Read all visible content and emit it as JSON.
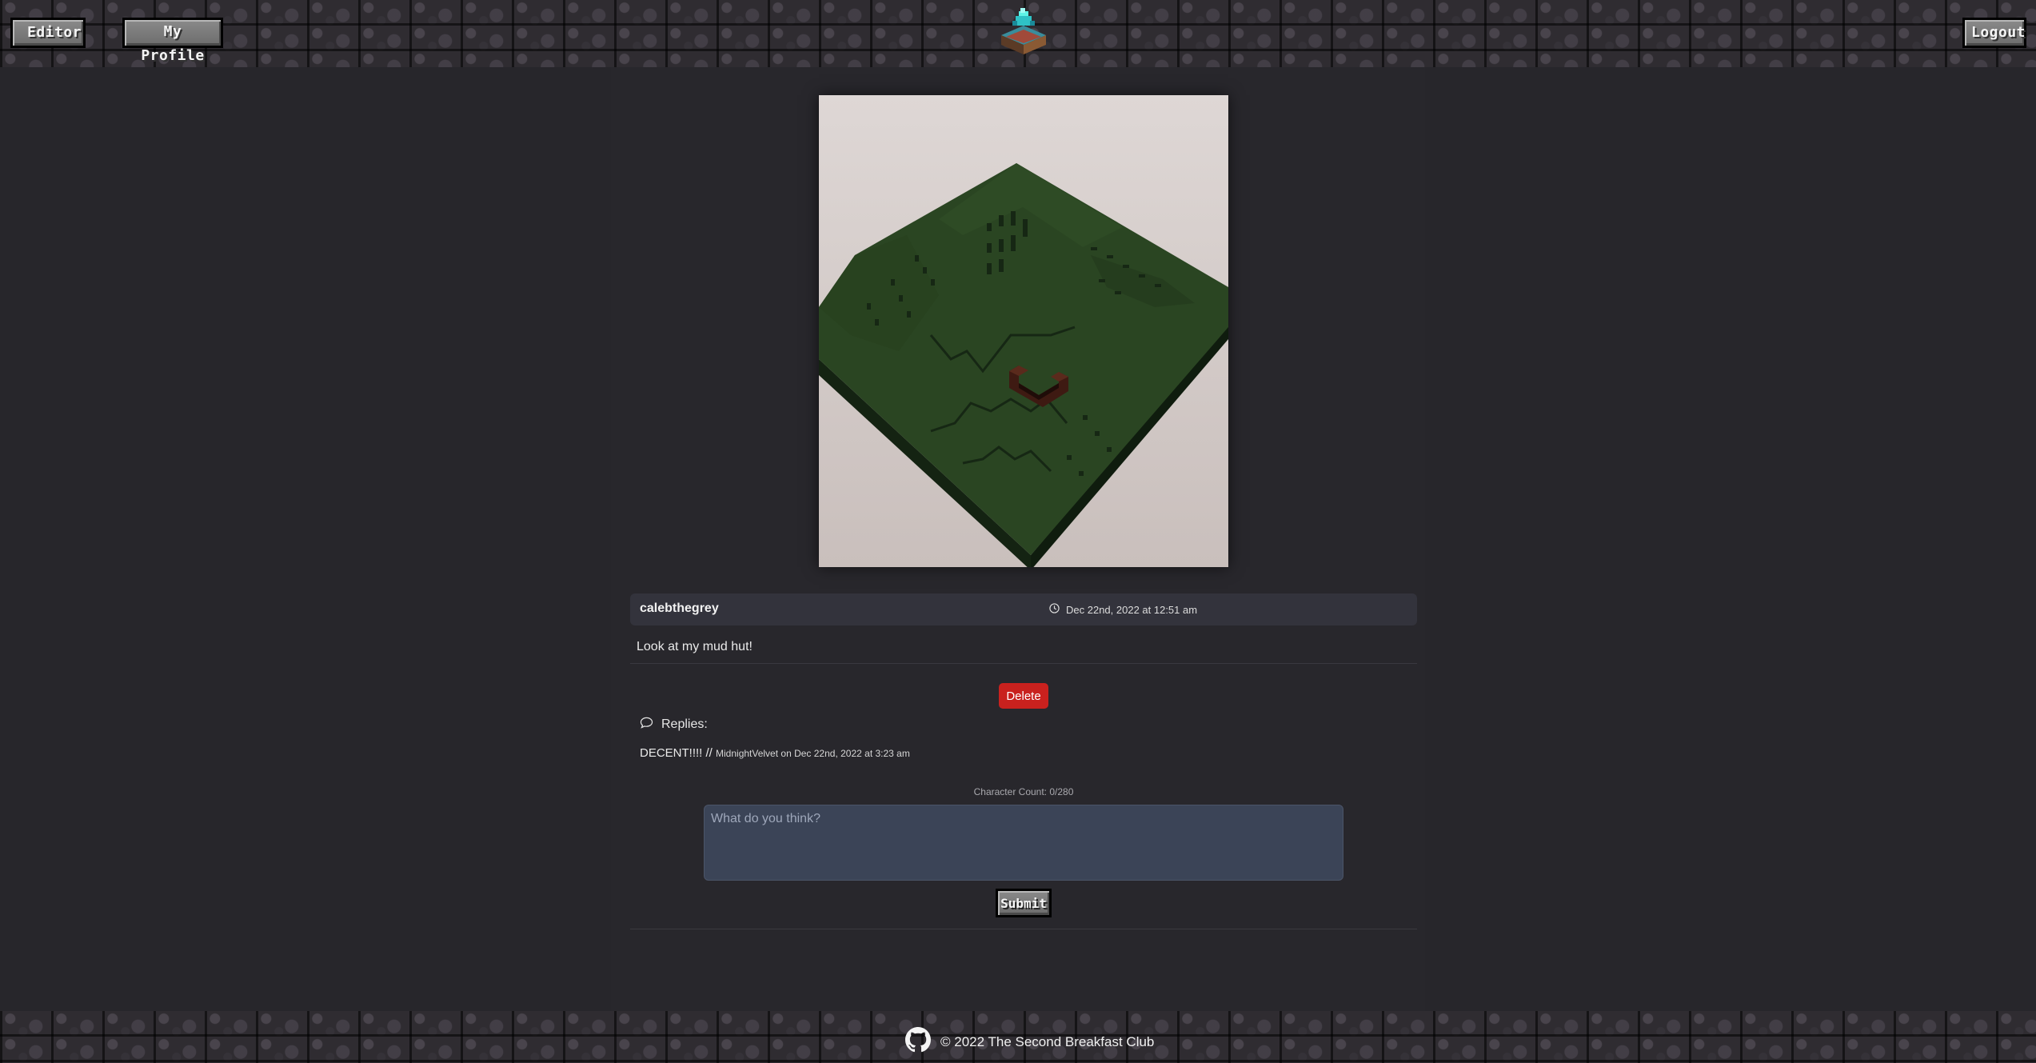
{
  "header": {
    "editor_label": "Editor",
    "profile_label": "My Profile",
    "logout_label": "Logout"
  },
  "post": {
    "author": "calebthegrey",
    "date": "Dec 22nd, 2022 at 12:51 am",
    "caption": "Look at my mud hut!",
    "delete_label": "Delete"
  },
  "replies": {
    "label": "Replies:",
    "items": [
      {
        "text": "DECENT!!!! //",
        "meta": "MidnightVelvet on Dec 22nd, 2022 at 3:23 am"
      }
    ]
  },
  "comment": {
    "char_count": "Character Count: 0/280",
    "placeholder": "What do you think?",
    "submit_label": "Submit"
  },
  "footer": {
    "copyright": "© 2022 The Second Breakfast Club"
  },
  "colors": {
    "background": "#27262b",
    "delete": "#c9211e",
    "input_bg": "#3b4457"
  }
}
